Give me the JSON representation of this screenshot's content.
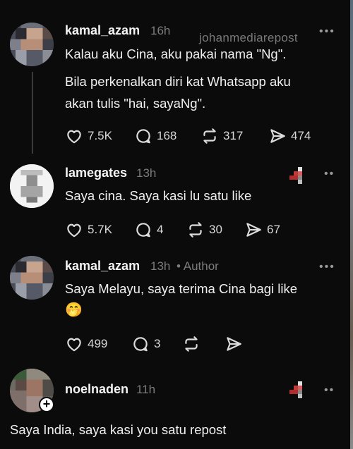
{
  "watermark": "johanmediarepost",
  "posts": [
    {
      "username": "kamal_azam",
      "time": "16h",
      "text_line1": "Kalau aku Cina, aku pakai nama \"Ng\".",
      "text_line2": "Bila perkenalkan diri kat Whatsapp aku",
      "text_line3": "akan tulis \"hai, sayaNg\".",
      "likes": "7.5K",
      "replies": "168",
      "reposts": "317",
      "shares": "474"
    },
    {
      "username": "lamegates",
      "time": "13h",
      "text": "Saya cina. Saya kasi lu satu like",
      "likes": "5.7K",
      "replies": "4",
      "reposts": "30",
      "shares": "67"
    },
    {
      "username": "kamal_azam",
      "time": "13h",
      "author_tag": "• Author",
      "text": "Saya Melayu, saya terima Cina bagi like",
      "emoji": "🤭",
      "likes": "499",
      "replies": "3"
    },
    {
      "username": "noelnaden",
      "time": "11h",
      "text": "Saya India, saya kasi you satu repost"
    }
  ],
  "more_icon": "•••",
  "more_icon_small": "••",
  "icons": [
    "heart-icon",
    "reply-bubble-icon",
    "repost-icon",
    "share-send-icon",
    "more-options-icon",
    "follow-plus-icon"
  ],
  "colors": {
    "background": "#0b0b0b",
    "text_primary": "#f2f2f2",
    "text_secondary": "#7c7c7c"
  }
}
